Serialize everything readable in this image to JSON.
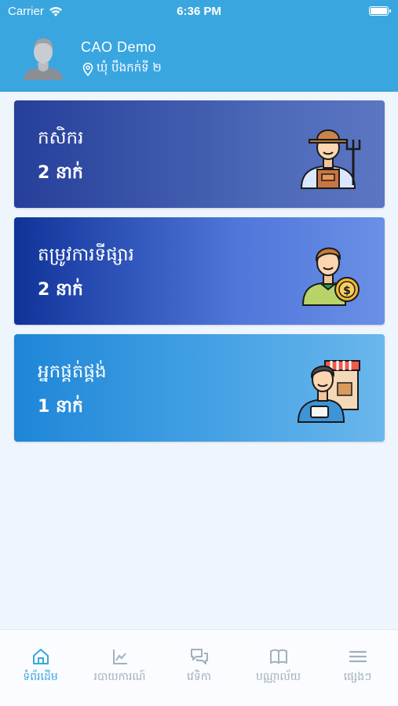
{
  "status_bar": {
    "carrier": "Carrier",
    "time": "6:36 PM"
  },
  "profile": {
    "name": "CAO Demo",
    "location": "ឃុំ បឹងកក់ទី ២"
  },
  "cards": [
    {
      "title": "កសិករ",
      "count": "2 នាក់",
      "icon": "farmer-icon"
    },
    {
      "title": "តម្រូវការទីផ្សារ",
      "count": "2 នាក់",
      "icon": "merchant-coin-icon"
    },
    {
      "title": "អ្នកផ្គត់ផ្គង់",
      "count": "1 នាក់",
      "icon": "supplier-shop-icon"
    }
  ],
  "tabs": [
    {
      "label": "ទំព័រដើម",
      "icon": "home-icon",
      "active": true
    },
    {
      "label": "របាយការណ៍",
      "icon": "chart-icon",
      "active": false
    },
    {
      "label": "វេទិកា",
      "icon": "chat-icon",
      "active": false
    },
    {
      "label": "បណ្ណាល័យ",
      "icon": "book-icon",
      "active": false
    },
    {
      "label": "ផ្សេងៗ",
      "icon": "menu-icon",
      "active": false
    }
  ],
  "colors": {
    "header": "#3aa6df",
    "tab_active": "#3aa6df",
    "tab_inactive": "#a3b0bc"
  }
}
